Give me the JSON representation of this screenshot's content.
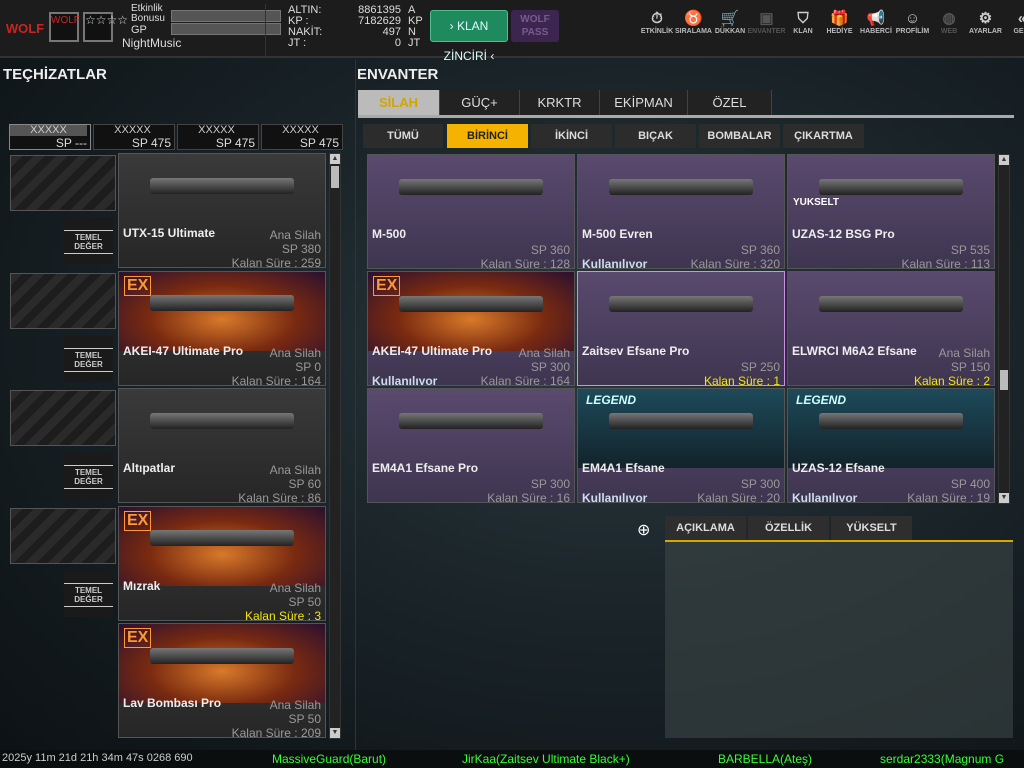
{
  "top": {
    "logo": "WOLF",
    "emblem": "WOLF",
    "rank": "☆☆☆☆",
    "etk_label": "Etkinlik Bonusu",
    "gp_label": "GP",
    "username": "NightMusic",
    "currency": [
      {
        "label": "ALTIN:",
        "value": "8861395",
        "unit": "A"
      },
      {
        "label": "KP :",
        "value": "7182629",
        "unit": "KP"
      },
      {
        "label": "NAKİT:",
        "value": "497",
        "unit": "N"
      },
      {
        "label": "JT :",
        "value": "0",
        "unit": "JT"
      }
    ],
    "klan_btn": "› KLAN ZİNCİRİ ‹",
    "wolf_btn": "WOLF PASS",
    "nav": [
      {
        "label": "ETKİNLİK",
        "icon": "⏱"
      },
      {
        "label": "SIRALAMA",
        "icon": "♉"
      },
      {
        "label": "DÜKKAN",
        "icon": "🛒"
      },
      {
        "label": "ENVANTER",
        "icon": "▣",
        "dim": true
      },
      {
        "label": "KLAN",
        "icon": "⛉"
      },
      {
        "label": "HEDİYE",
        "icon": "🎁"
      },
      {
        "label": "HABERCİ",
        "icon": "📢"
      },
      {
        "label": "PROFİLİM",
        "icon": "☺"
      },
      {
        "label": "WEB",
        "icon": "◍",
        "dim": true
      },
      {
        "label": "AYARLAR",
        "icon": "⚙"
      },
      {
        "label": "GERİ",
        "icon": "«"
      }
    ]
  },
  "left": {
    "title": "TEÇHİZATLAR",
    "tabs": [
      {
        "x": "XXXXX",
        "sp": "SP ---"
      },
      {
        "x": "XXXXX",
        "sp": "SP 475"
      },
      {
        "x": "XXXXX",
        "sp": "SP 475"
      },
      {
        "x": "XXXXX",
        "sp": "SP 475"
      }
    ],
    "temel": "TEMEL DEĞER",
    "items": [
      {
        "name": "UTX-15 Ultimate",
        "type": "Ana Silah",
        "sp": "SP 380",
        "ks": "Kalan Süre : 259"
      },
      {
        "name": "AKEI-47 Ultimate Pro",
        "type": "Ana Silah",
        "sp": "SP 0",
        "ks": "Kalan Süre : 164",
        "ex": "EX"
      },
      {
        "name": "Altıpatlar",
        "type": "Ana Silah",
        "sp": "SP 60",
        "ks": "Kalan Süre : 86"
      },
      {
        "name": "Mızrak",
        "type": "Ana Silah",
        "sp": "SP 50",
        "ks": "Kalan Süre : 3",
        "warn": true,
        "ex": "EX"
      },
      {
        "name": "Lav Bombası Pro",
        "type": "Ana Silah",
        "sp": "SP 50",
        "ks": "Kalan Süre : 209",
        "ex": "EX"
      }
    ]
  },
  "inv": {
    "title": "ENVANTER",
    "tabs": [
      "SİLAH",
      "GÜÇ+",
      "KRKTR",
      "EKİPMAN",
      "ÖZEL"
    ],
    "subtabs": [
      "TÜMÜ",
      "BİRİNCİ",
      "İKİNCİ",
      "BIÇAK",
      "BOMBALAR",
      "ÇIKARTMA"
    ],
    "items": [
      {
        "name": "M-500",
        "sp": "SP 360",
        "ks": "Kalan Süre : 128"
      },
      {
        "name": "M-500 Evren",
        "sp": "SP 360",
        "ks": "Kalan Süre : 320",
        "use": "Kullanılıyor"
      },
      {
        "name": "UZAS-12 BSG Pro",
        "sp": "SP 535",
        "ks": "Kalan Süre : 113",
        "badge": "YUKSELT"
      },
      {
        "name": "AKEI-47 Ultimate Pro",
        "type": "Ana Silah",
        "sp": "SP 300",
        "ks": "Kalan Süre : 164",
        "use": "Kullanılıyor",
        "ex": "EX"
      },
      {
        "name": "Zaitsev Efsane Pro",
        "sp": "SP 250",
        "ks": "Kalan Süre : 1",
        "warn": true,
        "sel": true
      },
      {
        "name": "ELWRCI M6A2 Efsane",
        "type": "Ana Silah",
        "sp": "SP 150",
        "ks": "Kalan Süre : 2",
        "warn": true
      },
      {
        "name": "EM4A1 Efsane Pro",
        "sp": "SP 300",
        "ks": "Kalan Süre : 16"
      },
      {
        "name": "EM4A1 Efsane",
        "sp": "SP 300",
        "ks": "Kalan Süre : 20",
        "use": "Kullanılıyor",
        "legend": "LEGEND"
      },
      {
        "name": "UZAS-12 Efsane",
        "sp": "SP 400",
        "ks": "Kalan Süre : 19",
        "use": "Kullanılıyor",
        "legend": "LEGEND"
      }
    ],
    "detail_tabs": [
      "AÇIKLAMA",
      "ÖZELLİK",
      "YÜKSELT"
    ]
  },
  "ticker": [
    "2025y 11m 21d 21h 34m 47s 0268 690",
    "MassiveGuard(Barut)",
    "JirKaa(Zaitsev Ultimate Black+)",
    "BARBELLA(Ateş)",
    "serdar2333(Magnum G"
  ]
}
